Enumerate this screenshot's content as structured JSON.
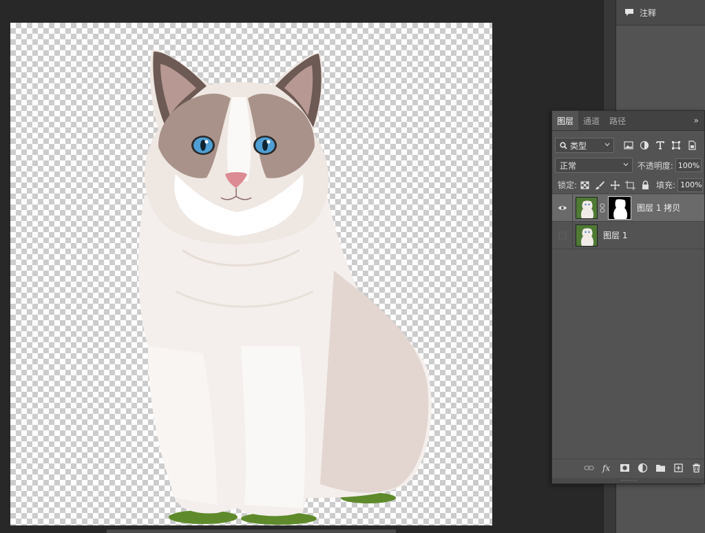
{
  "notes_panel": {
    "title": "注释",
    "icon": "comment-icon"
  },
  "layers_panel": {
    "tabs": [
      {
        "label": "图层",
        "active": true
      },
      {
        "label": "通道",
        "active": false
      },
      {
        "label": "路径",
        "active": false
      }
    ],
    "more_icon": "double-chevron-right-icon",
    "filter": {
      "kind_label": "类型",
      "icons": [
        "image-filter-icon",
        "adjustment-filter-icon",
        "type-filter-icon",
        "shape-filter-icon",
        "smart-object-filter-icon"
      ]
    },
    "blend_mode": "正常",
    "opacity": {
      "label": "不透明度:",
      "value": "100%"
    },
    "lock": {
      "label": "锁定:",
      "icons": [
        "lock-transparent-icon",
        "lock-paint-icon",
        "lock-position-icon",
        "lock-artboard-icon",
        "lock-all-icon"
      ]
    },
    "fill": {
      "label": "填充:",
      "value": "100%"
    },
    "layers": [
      {
        "name": "图层 1 拷贝",
        "visible": true,
        "selected": true,
        "has_mask": true
      },
      {
        "name": "图层 1",
        "visible": false,
        "selected": false,
        "has_mask": false
      }
    ],
    "bottom_icons": [
      "link-layers-icon",
      "fx-icon",
      "add-mask-icon",
      "adjustment-layer-icon",
      "new-group-icon",
      "new-layer-icon",
      "delete-icon"
    ]
  },
  "colors": {
    "app_bg": "#282828",
    "panel_bg": "#535353",
    "selected_row": "#6a6a6a",
    "tab_bar": "#424242"
  }
}
